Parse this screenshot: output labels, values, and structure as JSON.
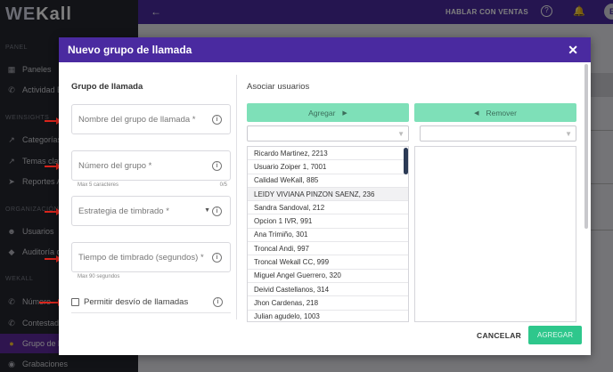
{
  "app": {
    "logo_part1": "WE",
    "logo_part2": "Kall"
  },
  "sidebar": {
    "sections": [
      "PANEL",
      "WEINSIGHTS",
      "ORGANIZACIÓN",
      "WEKALL"
    ],
    "items": [
      {
        "label": "Paneles",
        "icon": "grid-icon"
      },
      {
        "label": "Actividad E",
        "icon": "phone-icon"
      },
      {
        "label": "Categorías",
        "icon": "trend-icon"
      },
      {
        "label": "Temas clave",
        "icon": "trend-icon"
      },
      {
        "label": "Reportes A",
        "icon": "send-icon"
      },
      {
        "label": "Usuarios",
        "icon": "users-icon"
      },
      {
        "label": "Auditoría d",
        "icon": "shield-icon"
      },
      {
        "label": "Número",
        "icon": "phone-icon"
      },
      {
        "label": "Contestado",
        "icon": "phone-icon"
      },
      {
        "label": "Grupo de ll",
        "icon": "group-icon"
      },
      {
        "label": "Grabaciones",
        "icon": "record-icon"
      }
    ]
  },
  "topbar": {
    "back": "←",
    "sales": "HABLAR CON VENTAS",
    "help": "?",
    "avatar": "E"
  },
  "modal": {
    "title": "Nuevo grupo de llamada",
    "close": "✕",
    "left": {
      "title": "Grupo de llamada",
      "name_label": "Nombre del grupo de llamada *",
      "number_label": "Número del grupo *",
      "number_hint": "Max 5 caracteres",
      "number_count": "0/5",
      "strategy_label": "Estrategia de timbrado *",
      "ring_time_label": "Tiempo de timbrado (segundos) *",
      "ring_time_hint": "Max 90 segundos",
      "forward_label": "Permitir desvío de llamadas"
    },
    "right": {
      "title": "Asociar usuarios",
      "add_button": "Agregar",
      "remove_button": "Remover",
      "users": [
        "Ricardo Martinez, 2213",
        "Usuario Zoiper 1, 7001",
        "Calidad WeKall, 885",
        "LEIDY VIVIANA PINZON SAENZ, 236",
        "Sandra Sandoval, 212",
        "Opcion 1 IVR, 991",
        "Ana Trimiño, 301",
        "Troncal Andi, 997",
        "Troncal Wekall CC, 999",
        "Miguel Angel Guerrero, 320",
        "Deivid Castellanos, 314",
        "Jhon Cardenas, 218",
        "Julian agudelo, 1003"
      ]
    },
    "footer": {
      "cancel": "CANCELAR",
      "add": "AGREGAR"
    }
  }
}
